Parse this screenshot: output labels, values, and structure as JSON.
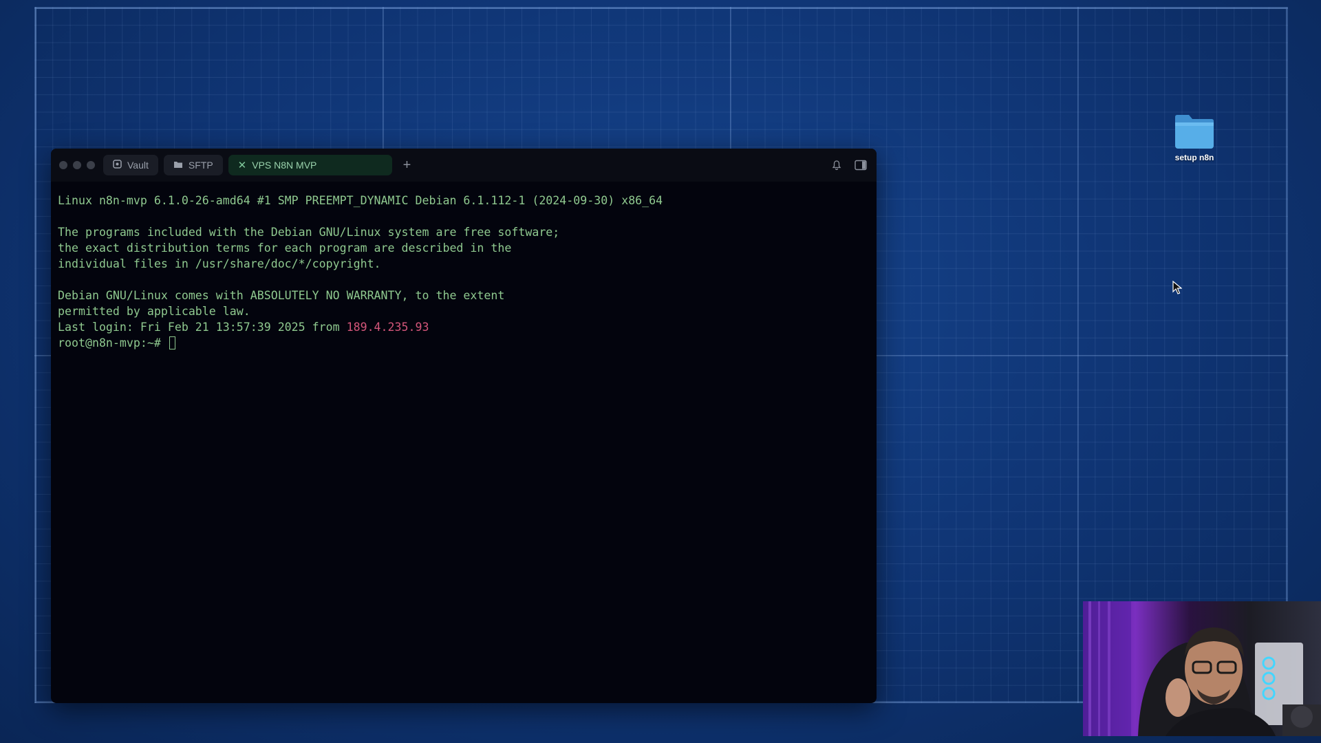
{
  "terminal": {
    "tabs": [
      {
        "label": "Vault",
        "icon": "vault-icon"
      },
      {
        "label": "SFTP",
        "icon": "folder-icon"
      },
      {
        "label": "VPS N8N MVP",
        "icon": "close-icon",
        "active": true
      }
    ],
    "add_tab_label": "+",
    "lines": {
      "uname": "Linux n8n-mvp 6.1.0-26-amd64 #1 SMP PREEMPT_DYNAMIC Debian 6.1.112-1 (2024-09-30) x86_64",
      "motd1": "The programs included with the Debian GNU/Linux system are free software;",
      "motd2": "the exact distribution terms for each program are described in the",
      "motd3": "individual files in /usr/share/doc/*/copyright.",
      "warranty1": "Debian GNU/Linux comes with ABSOLUTELY NO WARRANTY, to the extent",
      "warranty2": "permitted by applicable law.",
      "last_login_prefix": "Last login: Fri Feb 21 13:57:39 2025 from ",
      "last_login_ip": "189.4.235.93",
      "prompt": "root@n8n-mvp:~# "
    },
    "colors": {
      "text": "#8fc98f",
      "ip": "#d4567a",
      "background": "#03040d"
    }
  },
  "desktop": {
    "folder_label": "setup n8n",
    "folder_icon": "folder-icon",
    "folder_color": "#4fa3e3"
  }
}
